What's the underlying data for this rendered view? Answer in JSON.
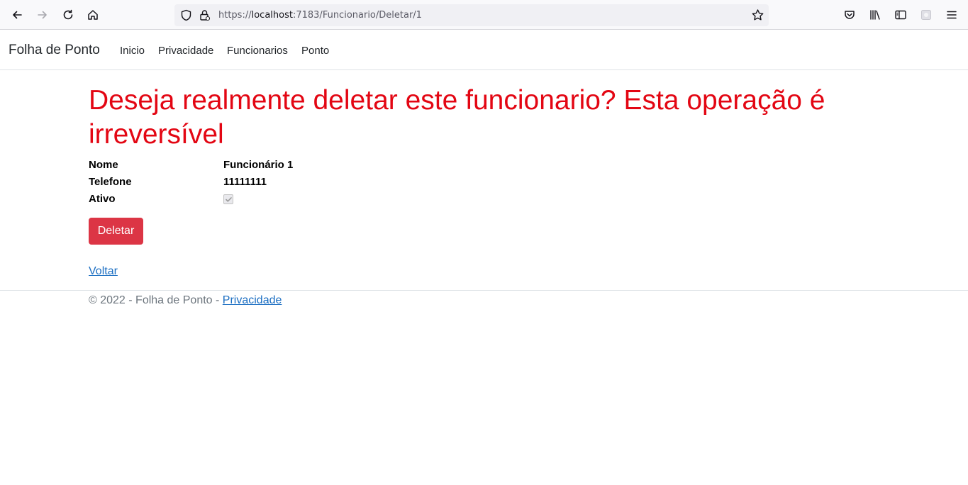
{
  "browser": {
    "url_prefix": "https://",
    "url_host": "localhost",
    "url_rest": ":7183/Funcionario/Deletar/1"
  },
  "navbar": {
    "brand": "Folha de Ponto",
    "links": [
      "Inicio",
      "Privacidade",
      "Funcionarios",
      "Ponto"
    ]
  },
  "main": {
    "title": "Deseja realmente deletar este funcionario? Esta operação é irreversível",
    "fields": [
      {
        "label": "Nome",
        "value": "Funcionário 1"
      },
      {
        "label": "Telefone",
        "value": "11111111"
      },
      {
        "label": "Ativo",
        "checked": true
      }
    ],
    "delete_label": "Deletar",
    "back_label": "Voltar"
  },
  "footer": {
    "text": "© 2022 - Folha de Ponto - ",
    "link": "Privacidade"
  },
  "colors": {
    "title": "#e30613",
    "danger": "#dc3545",
    "link": "#1b6ec2"
  },
  "icons": [
    "back-arrow-icon",
    "forward-arrow-icon",
    "reload-icon",
    "home-icon",
    "shield-icon",
    "lock-icon",
    "star-icon",
    "pocket-icon",
    "library-icon",
    "sidebar-icon",
    "extension-icon",
    "menu-icon"
  ]
}
